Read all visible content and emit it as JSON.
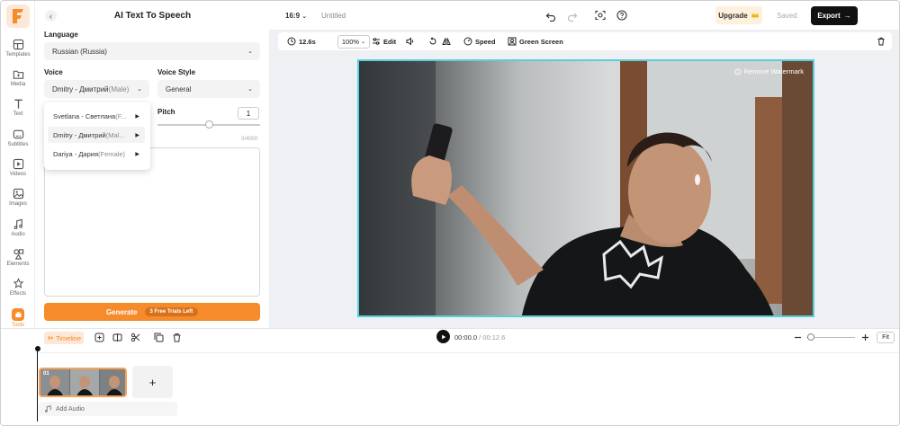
{
  "colors": {
    "accent": "#f58b2a",
    "selection": "#57d0dd",
    "dark": "#111111"
  },
  "sidebar": {
    "items": [
      {
        "label": "Templates",
        "icon": "templates-icon"
      },
      {
        "label": "Media",
        "icon": "media-icon"
      },
      {
        "label": "Text",
        "icon": "text-icon"
      },
      {
        "label": "Subtitles",
        "icon": "subtitles-icon"
      },
      {
        "label": "Videos",
        "icon": "videos-icon"
      },
      {
        "label": "Images",
        "icon": "images-icon"
      },
      {
        "label": "Audio",
        "icon": "audio-icon"
      },
      {
        "label": "Elements",
        "icon": "elements-icon"
      },
      {
        "label": "Effects",
        "icon": "effects-icon"
      },
      {
        "label": "Tools",
        "icon": "tools-icon",
        "active": true
      }
    ]
  },
  "panel": {
    "title": "AI Text To Speech",
    "language_label": "Language",
    "language_value": "Russian (Russia)",
    "voice_label": "Voice",
    "voice_name": "Dmitry - Дмитрий",
    "voice_gender": "(Male)",
    "voice_style_label": "Voice Style",
    "voice_style_value": "General",
    "pitch_label": "Pitch",
    "pitch_value": "1",
    "char_count": "0/4000",
    "generate_label": "Generate",
    "trials_badge": "3 Free Trials Left"
  },
  "voice_dropdown": [
    {
      "name": "Svetlana - Светлана",
      "gender": "(F..."
    },
    {
      "name": "Dmitry - Дмитрий",
      "gender": "(Mal...",
      "highlighted": true
    },
    {
      "name": "Dariya - Дария",
      "gender": "(Female)"
    }
  ],
  "topbar": {
    "aspect": "16:9",
    "project_name": "Untitled",
    "upgrade_label": "Upgrade",
    "saved_label": "Saved",
    "export_label": "Export"
  },
  "canvas_toolbar": {
    "duration": "12.6s",
    "zoom": "100%",
    "edit_label": "Edit",
    "speed_label": "Speed",
    "green_screen_label": "Green Screen"
  },
  "preview": {
    "watermark_label": "Remove Watermark"
  },
  "timeline": {
    "tab_label": "Timeline",
    "current_time": "00:00.0",
    "total_time": "/ 00:12.6",
    "zoom_level": 0.1,
    "fit_label": "Fit",
    "clip_number": "01",
    "add_audio_label": "Add Audio"
  }
}
